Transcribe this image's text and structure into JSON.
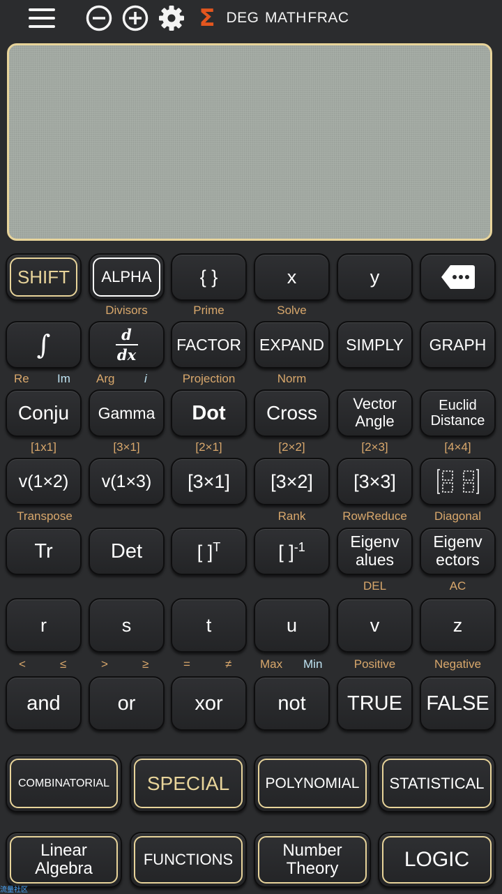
{
  "topbar": {
    "deg": "DEG",
    "math": "MATH",
    "frac": "FRAC",
    "sigma": "Σ"
  },
  "colors": {
    "background": "#2b2c2e",
    "key_label": "#d9a86c",
    "key_label_alt": "#bfe3f2",
    "gold_border": "#e8d49a",
    "display": "#a9b0a9",
    "sigma": "#e4561e"
  },
  "keys": {
    "r1": [
      "SHIFT",
      "ALPHA",
      "{ }",
      "x",
      "y"
    ],
    "r2": [
      "FACTOR",
      "EXPAND",
      "SIMPLY",
      "GRAPH"
    ],
    "r2_labels": [
      "Divisors",
      "Prime",
      "Solve"
    ],
    "r3": [
      "Conju",
      "Gamma",
      "Dot",
      "Cross"
    ],
    "r3_vector": [
      "Vector",
      "Angle"
    ],
    "r3_euclid": [
      "Euclid",
      "Distance"
    ],
    "r3_labels": [
      "Re",
      "Im",
      "Arg",
      "i",
      "Projection",
      "Norm"
    ],
    "r4": [
      "v(1×2)",
      "v(1×3)",
      "[3×1]",
      "[3×2]",
      "[3×3]"
    ],
    "r4_labels": [
      "[1x1]",
      "[3×1]",
      "[2×1]",
      "[2×2]",
      "[2×3]",
      "[4×4]"
    ],
    "r5": [
      "Tr",
      "Det",
      "[ ]",
      "T",
      "[ ]",
      "-1"
    ],
    "r5_eigval": [
      "Eigenv",
      "alues"
    ],
    "r5_eigvec": [
      "Eigenv",
      "ectors"
    ],
    "r5_labels": [
      "Transpose",
      "Rank",
      "RowReduce",
      "Diagonal"
    ],
    "r6": [
      "r",
      "s",
      "t",
      "u",
      "v",
      "z"
    ],
    "r6_labels": [
      "DEL",
      "AC"
    ],
    "r7": [
      "and",
      "or",
      "xor",
      "not",
      "TRUE",
      "FALSE"
    ],
    "r7_labels": [
      "<",
      "≤",
      ">",
      "≥",
      "=",
      "≠",
      "Max",
      "Min",
      "Positive",
      "Negative"
    ],
    "derivative": [
      "d",
      "dx"
    ]
  },
  "modes": {
    "row1": [
      "COMBINATORIAL",
      "SPECIAL",
      "POLYNOMIAL",
      "STATISTICAL"
    ],
    "row2": [
      "FUNCTIONS",
      "LOGIC"
    ],
    "linear": [
      "Linear",
      "Algebra"
    ],
    "number": [
      "Number",
      "Theory"
    ]
  },
  "watermark": "流量社区"
}
